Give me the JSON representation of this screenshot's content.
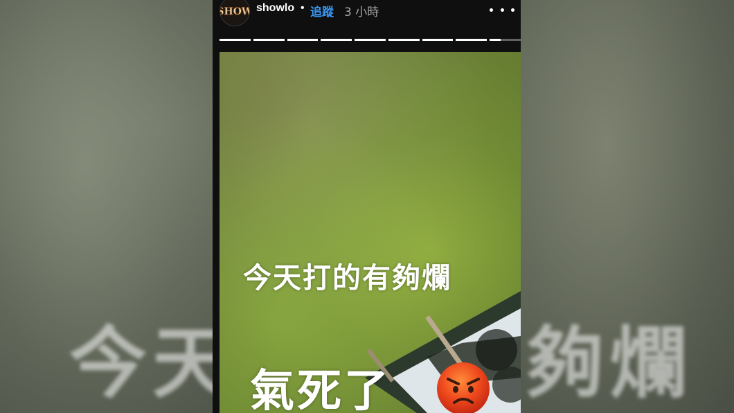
{
  "story": {
    "username": "showlo",
    "separator": "•",
    "follow_label": "追蹤",
    "time_ago": "3 小時",
    "avatar_icon": "show-logo-avatar",
    "more_icon": "more-options-icon",
    "progress": {
      "segment_count": 9,
      "current_segment_fill": 0.35
    },
    "caption_line1": "今天打的有夠爛",
    "caption_line2": "氣死了",
    "emoji": "angry-face-emoji"
  },
  "colors": {
    "follow_blue": "#3897f0",
    "story_background": "#0f0f0f",
    "caption_text": "#ffffff"
  }
}
